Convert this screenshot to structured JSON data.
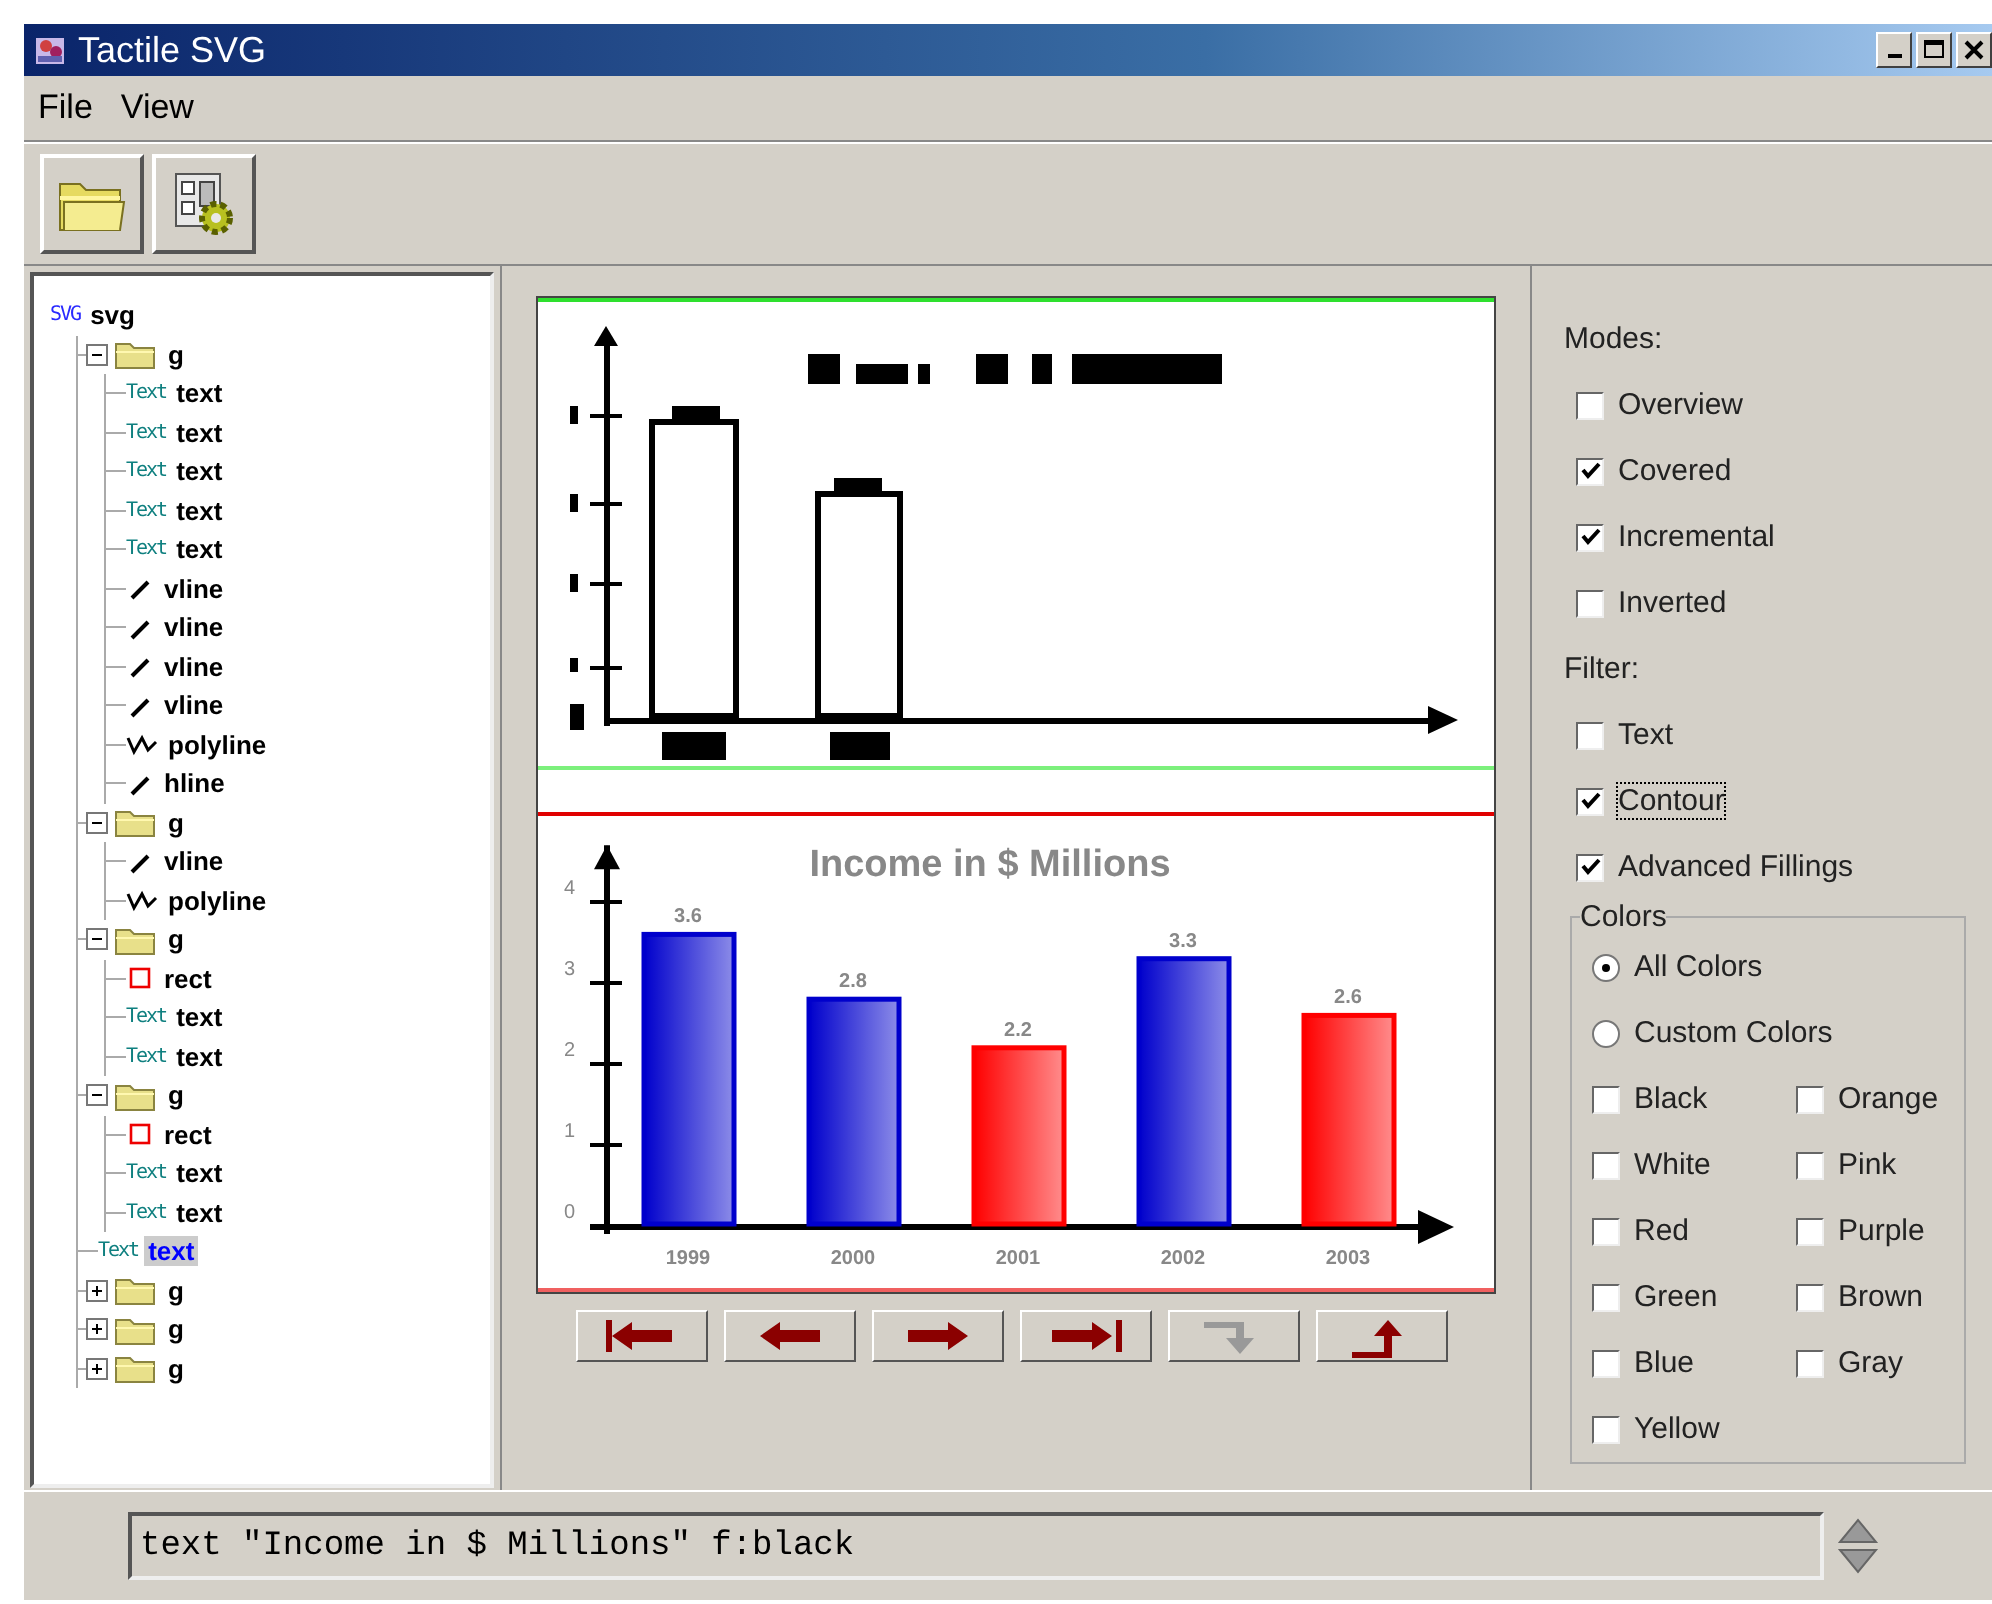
{
  "window": {
    "title": "Tactile SVG"
  },
  "menu": [
    "File",
    "View"
  ],
  "tree": [
    {
      "kind": "svg",
      "tag": "SVG",
      "label": "svg",
      "selected": false,
      "children": [
        {
          "kind": "g",
          "label": "g",
          "expanded": true,
          "selected": false,
          "children": [
            {
              "kind": "text",
              "tag": "Text",
              "label": "text",
              "selected": false
            },
            {
              "kind": "text",
              "tag": "Text",
              "label": "text",
              "selected": false
            },
            {
              "kind": "text",
              "tag": "Text",
              "label": "text",
              "selected": false
            },
            {
              "kind": "text",
              "tag": "Text",
              "label": "text",
              "selected": false
            },
            {
              "kind": "text",
              "tag": "Text",
              "label": "text",
              "selected": false
            },
            {
              "kind": "line",
              "label": "vline",
              "selected": false
            },
            {
              "kind": "line",
              "label": "vline",
              "selected": false
            },
            {
              "kind": "line",
              "label": "vline",
              "selected": false
            },
            {
              "kind": "line",
              "label": "vline",
              "selected": false
            },
            {
              "kind": "polyline",
              "label": "polyline",
              "selected": false
            },
            {
              "kind": "line",
              "label": "hline",
              "selected": false
            }
          ]
        },
        {
          "kind": "g",
          "label": "g",
          "expanded": true,
          "selected": false,
          "children": [
            {
              "kind": "line",
              "label": "vline",
              "selected": false
            },
            {
              "kind": "polyline",
              "label": "polyline",
              "selected": false
            }
          ]
        },
        {
          "kind": "g",
          "label": "g",
          "expanded": true,
          "selected": false,
          "children": [
            {
              "kind": "rect",
              "label": "rect",
              "selected": false
            },
            {
              "kind": "text",
              "tag": "Text",
              "label": "text",
              "selected": false
            },
            {
              "kind": "text",
              "tag": "Text",
              "label": "text",
              "selected": false
            }
          ]
        },
        {
          "kind": "g",
          "label": "g",
          "expanded": true,
          "selected": false,
          "children": [
            {
              "kind": "rect",
              "label": "rect",
              "selected": false
            },
            {
              "kind": "text",
              "tag": "Text",
              "label": "text",
              "selected": false
            },
            {
              "kind": "text",
              "tag": "Text",
              "label": "text",
              "selected": false
            }
          ]
        },
        {
          "kind": "text",
          "tag": "Text",
          "label": "text",
          "selected": true
        },
        {
          "kind": "g",
          "label": "g",
          "expanded": false,
          "selected": false
        },
        {
          "kind": "g",
          "label": "g",
          "expanded": false,
          "selected": false
        },
        {
          "kind": "g",
          "label": "g",
          "expanded": false,
          "selected": false
        }
      ]
    }
  ],
  "preview": {
    "chart_data": {
      "type": "bar",
      "title": "Income in $ Millions",
      "categories": [
        "1999",
        "2000",
        "2001",
        "2002",
        "2003"
      ],
      "values": [
        3.6,
        2.8,
        2.2,
        3.3,
        2.6
      ],
      "colors": [
        "#0000cc",
        "#0000cc",
        "#ff0000",
        "#0000cc",
        "#ff0000"
      ],
      "yticks": [
        0,
        1,
        2,
        3,
        4
      ],
      "ylim": [
        0,
        4.7
      ],
      "data_labels": true
    }
  },
  "nav_buttons": [
    {
      "kind": "first",
      "disabled": false
    },
    {
      "kind": "previous",
      "disabled": false
    },
    {
      "kind": "next",
      "disabled": false
    },
    {
      "kind": "last",
      "disabled": false
    },
    {
      "kind": "down",
      "disabled": true
    },
    {
      "kind": "up",
      "disabled": false
    }
  ],
  "options": {
    "modes_label": "Modes:",
    "modes": [
      {
        "label": "Overview",
        "checked": false,
        "focused": false
      },
      {
        "label": "Covered",
        "checked": true,
        "focused": false
      },
      {
        "label": "Incremental",
        "checked": true,
        "focused": false
      },
      {
        "label": "Inverted",
        "checked": false,
        "focused": false
      }
    ],
    "filter_label": "Filter:",
    "filters": [
      {
        "label": "Text",
        "checked": false,
        "focused": false
      },
      {
        "label": "Contour",
        "checked": true,
        "focused": true
      },
      {
        "label": "Advanced Fillings",
        "checked": true,
        "focused": false
      }
    ],
    "colors": {
      "legend": "Colors",
      "choices": [
        {
          "label": "All Colors",
          "selected": true
        },
        {
          "label": "Custom Colors",
          "selected": false
        }
      ],
      "items": [
        {
          "label": "Black",
          "checked": false
        },
        {
          "label": "Orange",
          "checked": false
        },
        {
          "label": "White",
          "checked": false
        },
        {
          "label": "Pink",
          "checked": false
        },
        {
          "label": "Red",
          "checked": false
        },
        {
          "label": "Purple",
          "checked": false
        },
        {
          "label": "Green",
          "checked": false
        },
        {
          "label": "Brown",
          "checked": false
        },
        {
          "label": "Blue",
          "checked": false
        },
        {
          "label": "Gray",
          "checked": false
        },
        {
          "label": "Yellow",
          "checked": false
        }
      ]
    }
  },
  "status": {
    "value": "text \"Income in $ Millions\" f:black"
  }
}
